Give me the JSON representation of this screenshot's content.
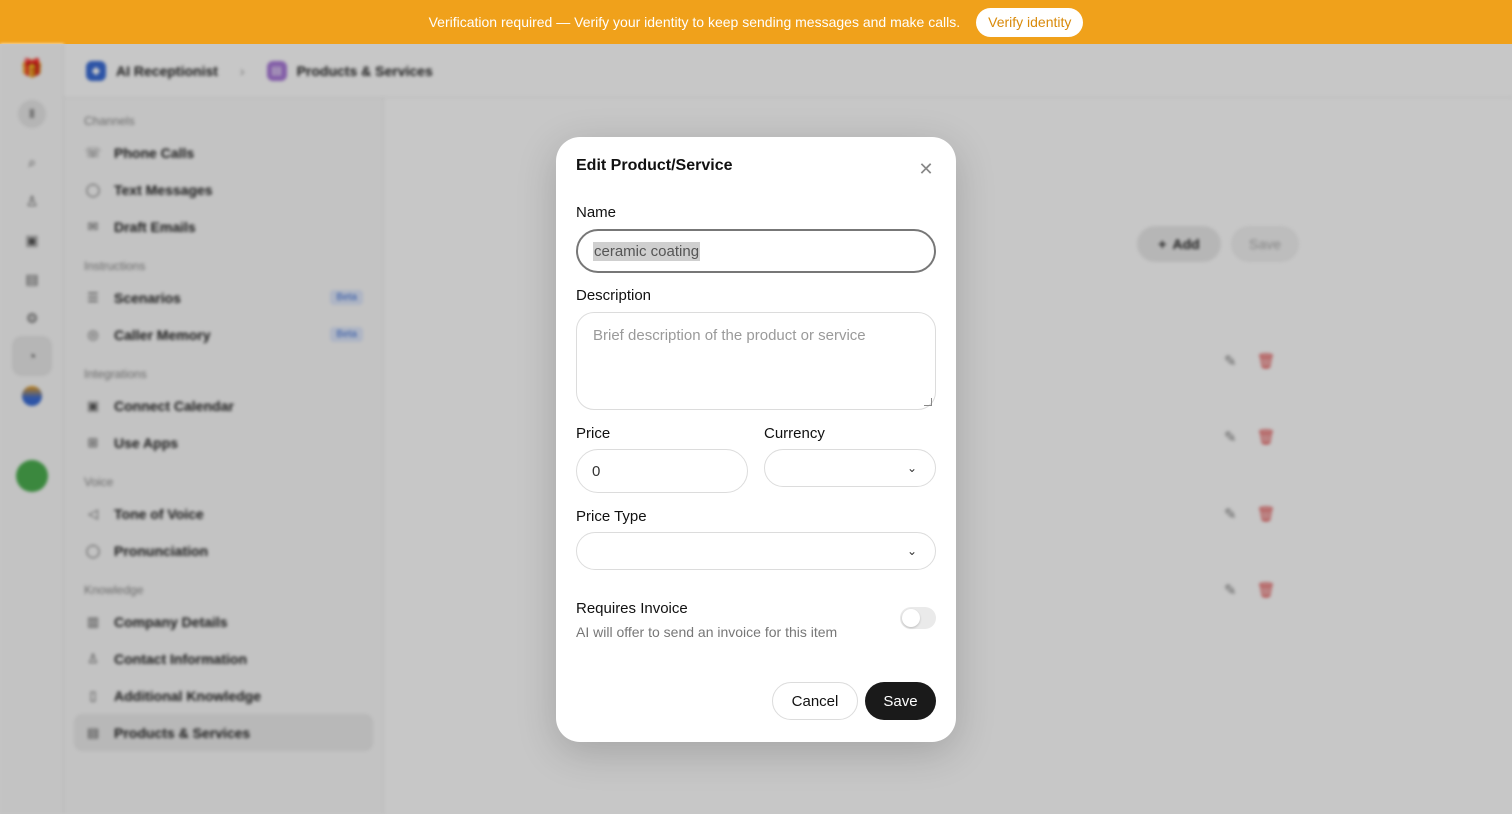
{
  "banner": {
    "text": "Verification required — Verify your identity to keep sending messages and make calls.",
    "button": "Verify identity",
    "color": "#f0a11b"
  },
  "header": {
    "crumb_1": "AI Receptionist",
    "crumb_2": "Products & Services"
  },
  "sidebar": {
    "sections": {
      "channels": "Channels",
      "instructions": "Instructions",
      "integrations": "Integrations",
      "voice": "Voice",
      "knowledge": "Knowledge"
    },
    "items": {
      "phone_calls": "Phone Calls",
      "text_messages": "Text Messages",
      "draft_emails": "Draft Emails",
      "scenarios": "Scenarios",
      "caller_memory": "Caller Memory",
      "connect_calendar": "Connect Calendar",
      "use_apps": "Use Apps",
      "tone_of_voice": "Tone of Voice",
      "pronunciation": "Pronunciation",
      "company_details": "Company Details",
      "contact_information": "Contact Information",
      "additional_knowledge": "Additional Knowledge",
      "products_services": "Products & Services"
    },
    "beta_label": "Beta"
  },
  "content": {
    "add_button": "Add",
    "save_button": "Save"
  },
  "modal": {
    "title": "Edit Product/Service",
    "name_label": "Name",
    "name_value": "ceramic coating",
    "description_label": "Description",
    "description_placeholder": "Brief description of the product or service",
    "price_label": "Price",
    "price_value": "0",
    "currency_label": "Currency",
    "currency_value": "",
    "price_type_label": "Price Type",
    "price_type_value": "",
    "requires_invoice_label": "Requires Invoice",
    "requires_invoice_desc": "AI will offer to send an invoice for this item",
    "requires_invoice_on": false,
    "cancel_button": "Cancel",
    "save_button": "Save"
  }
}
